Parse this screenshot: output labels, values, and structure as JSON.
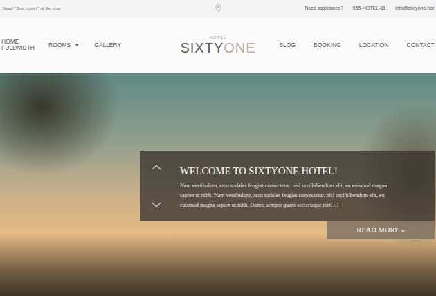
{
  "top_bar": {
    "tagline": "Voted \"Best resort\" of the year",
    "assistance": "Need assistance?",
    "phone": "555-HOTEL-81",
    "email": "info@sixtyone.hot"
  },
  "logo": {
    "small": "HOTEL",
    "dark": "SIXTY",
    "light": "ONE"
  },
  "nav_left": [
    {
      "label": "HOME FULLWIDTH",
      "dropdown": false
    },
    {
      "label": "ROOMS",
      "dropdown": true
    },
    {
      "label": "GALLERY",
      "dropdown": false
    }
  ],
  "nav_right": [
    {
      "label": "BLOG",
      "dropdown": false
    },
    {
      "label": "BOOKING",
      "dropdown": false
    },
    {
      "label": "LOCATION",
      "dropdown": false
    },
    {
      "label": "CONTACT",
      "dropdown": false
    }
  ],
  "slider": {
    "title": "WELCOME TO SIXTYONE HOTEL!",
    "text": "Nam vestibulum, arcu sodales feugiat consectetur, nisl orci bibendum elit, eu euismod magna sapien ut nibh. Nam vestibulum, arcu sodales feugiat consectetur, nisl orci bibendum elit, eu euismod magna sapien ut nibh. Donec semper quam scelerisque tort[...]",
    "button": "READ MORE »"
  }
}
